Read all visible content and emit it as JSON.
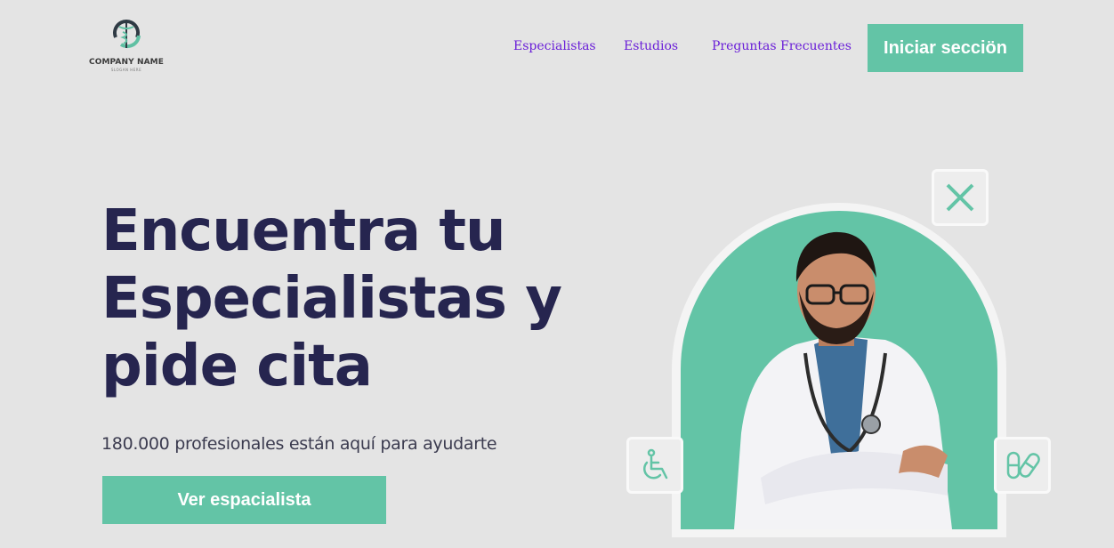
{
  "header": {
    "logo": {
      "name": "COMPANY NAME",
      "tagline": "SLOGAN HERE",
      "icon": "caduceus-icon"
    },
    "nav": [
      {
        "label": "Especialistas"
      },
      {
        "label": "Estudios"
      },
      {
        "label": "Preguntas Frecuentes"
      }
    ],
    "login_label": "Iniciar secciön"
  },
  "hero": {
    "title_lines": [
      "Encuentra tu",
      "Especialistas y",
      "pide cita"
    ],
    "subtitle": "180.000 profesionales están aquí para ayudarte",
    "cta_label": "Ver espacialista",
    "badges": [
      "close-icon",
      "wheelchair-icon",
      "pill-icon"
    ]
  },
  "colors": {
    "accent": "#63c4a6",
    "heading": "#26254f",
    "nav_link": "#6a1fd8",
    "background": "#e4e4e4"
  }
}
